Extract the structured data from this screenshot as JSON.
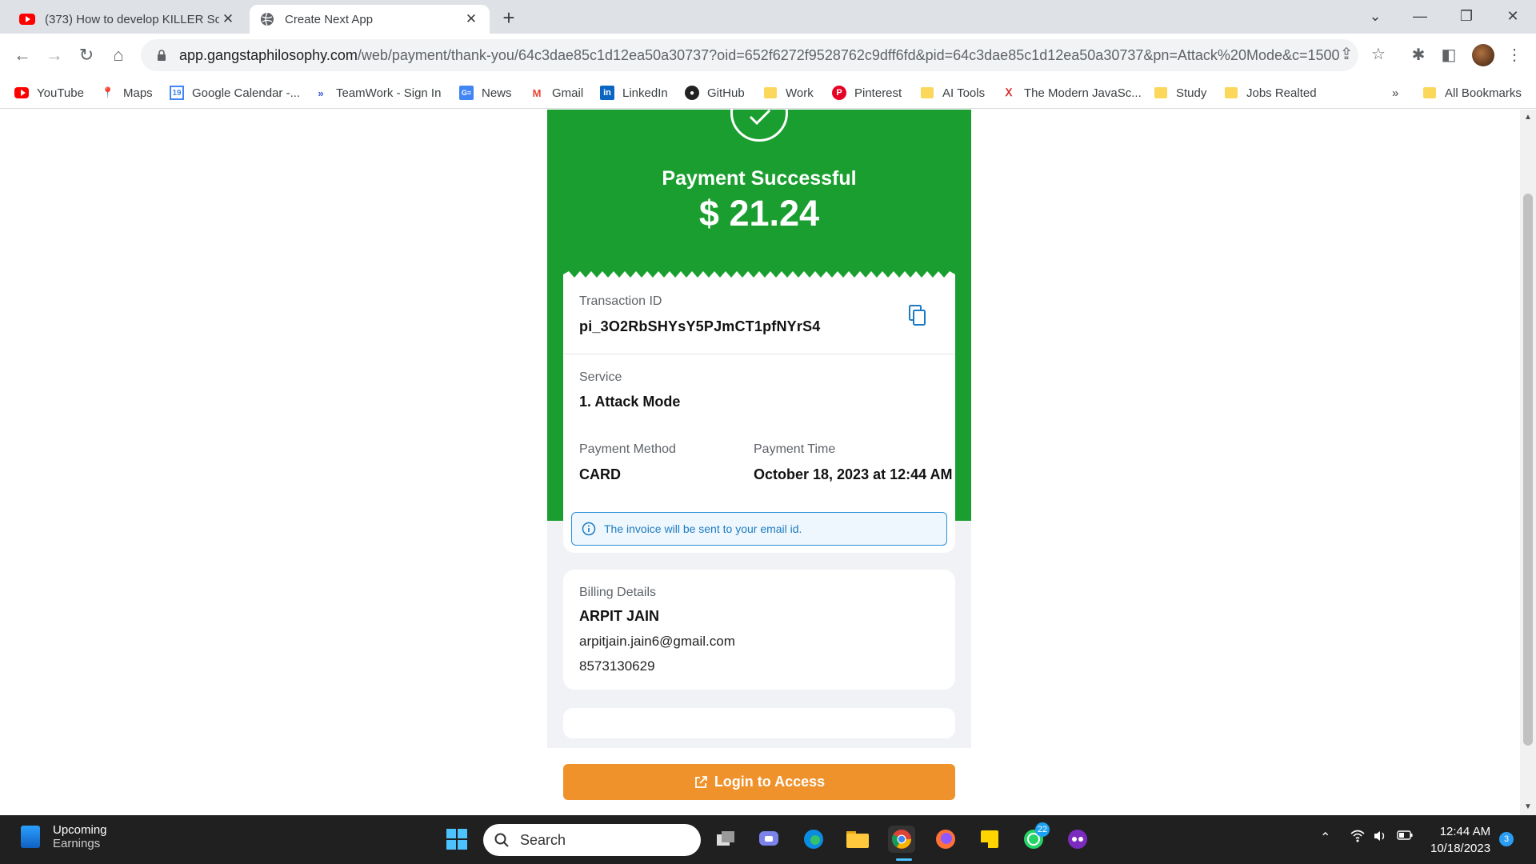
{
  "browser": {
    "tabs": [
      {
        "title": "(373) How to develop KILLER Soc",
        "icon": "youtube-icon",
        "active": false
      },
      {
        "title": "Create Next App",
        "icon": "globe-icon",
        "active": true
      }
    ],
    "url_domain": "app.gangstaphilosophy.com",
    "url_path": "/web/payment/thank-you/64c3dae85c1d12ea50a30737?oid=652f6272f9528762c9dff6fd&pid=64c3dae85c1d12ea50a30737&pn=Attack%20Mode&c=1500...",
    "bookmarks": [
      {
        "label": "YouTube",
        "icon": "youtube-icon"
      },
      {
        "label": "Maps",
        "icon": "maps-pin-icon"
      },
      {
        "label": "Google Calendar -...",
        "icon": "calendar-icon"
      },
      {
        "label": "TeamWork - Sign In",
        "icon": "teamwork-icon"
      },
      {
        "label": "News",
        "icon": "news-icon"
      },
      {
        "label": "Gmail",
        "icon": "gmail-icon"
      },
      {
        "label": "LinkedIn",
        "icon": "linkedin-icon"
      },
      {
        "label": "GitHub",
        "icon": "github-icon"
      },
      {
        "label": "Work",
        "icon": "folder-icon"
      },
      {
        "label": "Pinterest",
        "icon": "pinterest-icon"
      },
      {
        "label": "AI Tools",
        "icon": "folder-icon"
      },
      {
        "label": "The Modern JavaSc...",
        "icon": "javascript-icon"
      },
      {
        "label": "Study",
        "icon": "folder-icon"
      },
      {
        "label": "Jobs Realted",
        "icon": "folder-icon"
      }
    ],
    "more_bookmarks": "»",
    "all_bookmarks": "All Bookmarks"
  },
  "payment": {
    "status": "Payment Successful",
    "amount": "$ 21.24",
    "transaction_label": "Transaction ID",
    "transaction_id": "pi_3O2RbSHYsY5PJmCT1pfNYrS4",
    "service_label": "Service",
    "service_value": "1. Attack Mode",
    "method_label": "Payment Method",
    "method_value": "CARD",
    "time_label": "Payment Time",
    "time_value": "October 18, 2023 at 12:44 AM",
    "info_text": "The invoice will be sent to your email id."
  },
  "billing": {
    "label": "Billing Details",
    "name": "ARPIT JAIN",
    "email": "arpitjain.jain6@gmail.com",
    "phone": "8573130629"
  },
  "login_button": "Login to Access",
  "taskbar": {
    "widget_title": "Upcoming",
    "widget_subtitle": "Earnings",
    "search_placeholder": "Search",
    "whatsapp_badge": "22",
    "time": "12:44 AM",
    "date": "10/18/2023",
    "notification_count": "3"
  },
  "colors": {
    "success_green": "#1a9e2f",
    "cta_orange": "#f0922b",
    "info_blue": "#1e7bc2"
  }
}
